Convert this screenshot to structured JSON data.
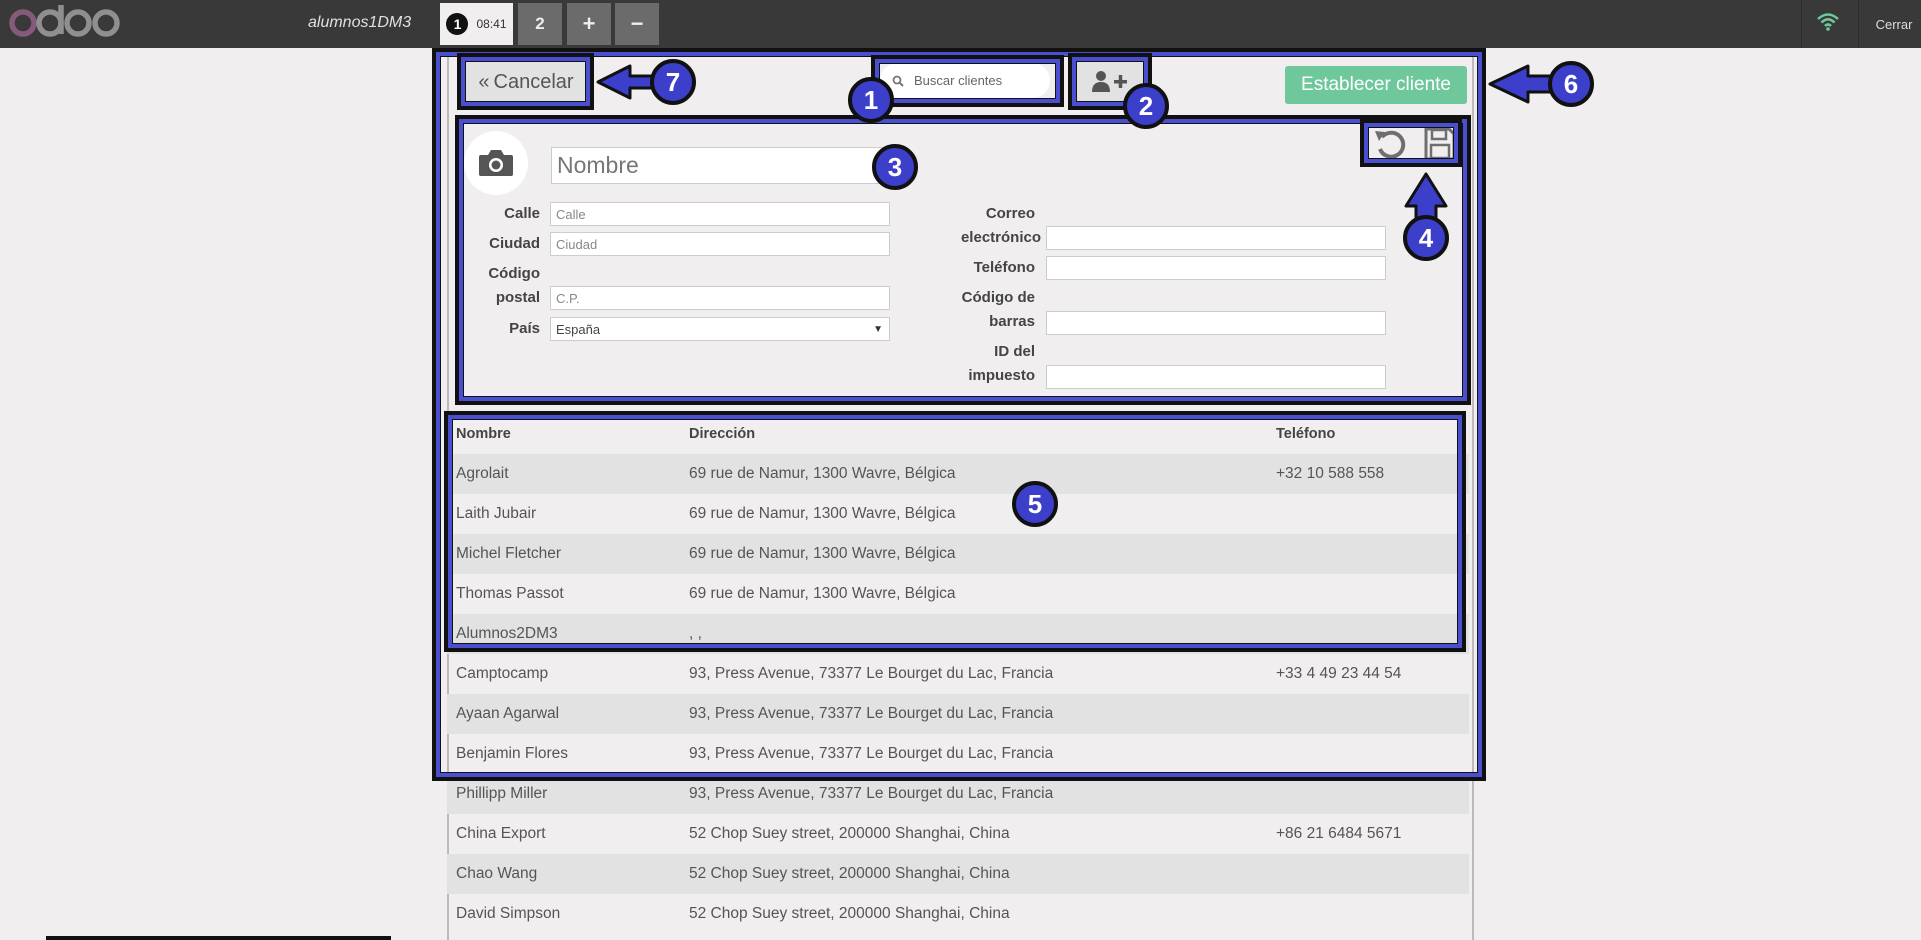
{
  "topbar": {
    "shop_name": "alumnos1DM3",
    "orders": [
      {
        "number": "1",
        "time": "08:41"
      },
      {
        "label": "2"
      }
    ],
    "add_order_label": "+",
    "remove_order_label": "−",
    "close_label": "Cerrar",
    "colors": {
      "bar": "#393939",
      "logo_o": "#875A7B",
      "logo_doo": "#8f8f8f",
      "wifi": "#6ec89b"
    }
  },
  "toolbar": {
    "cancel_label": "Cancelar",
    "cancel_icon": "double-chevron-left-icon",
    "search_placeholder": "Buscar clientes",
    "search_icon": "magnifier-icon",
    "new_customer_icon": "user-plus-icon",
    "set_customer_label": "Establecer cliente",
    "set_customer_color": "#6ec89b"
  },
  "form": {
    "name_placeholder": "Nombre",
    "avatar_icon": "camera-icon",
    "street_label": "Calle",
    "street_placeholder": "Calle",
    "city_label": "Ciudad",
    "city_placeholder": "Ciudad",
    "zip_label_1": "Código",
    "zip_label_2": "postal",
    "zip_placeholder": "C.P.",
    "country_label": "País",
    "country_value": "España",
    "email_label_1": "Correo",
    "email_label_2": "electrónico",
    "phone_label": "Teléfono",
    "barcode_label_1": "Código de",
    "barcode_label_2": "barras",
    "tax_label_1": "ID del",
    "tax_label_2": "impuesto",
    "undo_icon": "undo-icon",
    "save_icon": "floppy-disk-icon"
  },
  "table": {
    "headers": [
      "Nombre",
      "Dirección",
      "Teléfono"
    ],
    "rows": [
      [
        "Agrolait",
        "69 rue de Namur, 1300 Wavre, Bélgica",
        "+32 10 588 558"
      ],
      [
        "Laith Jubair",
        "69 rue de Namur, 1300 Wavre, Bélgica",
        ""
      ],
      [
        "Michel Fletcher",
        "69 rue de Namur, 1300 Wavre, Bélgica",
        ""
      ],
      [
        "Thomas Passot",
        "69 rue de Namur, 1300 Wavre, Bélgica",
        ""
      ],
      [
        "Alumnos2DM3",
        ", ,",
        ""
      ],
      [
        "Camptocamp",
        "93, Press Avenue, 73377 Le Bourget du Lac, Francia",
        "+33 4 49 23 44 54"
      ],
      [
        "Ayaan Agarwal",
        "93, Press Avenue, 73377 Le Bourget du Lac, Francia",
        ""
      ],
      [
        "Benjamin Flores",
        "93, Press Avenue, 73377 Le Bourget du Lac, Francia",
        ""
      ],
      [
        "Phillipp Miller",
        "93, Press Avenue, 73377 Le Bourget du Lac, Francia",
        ""
      ],
      [
        "China Export",
        "52 Chop Suey street, 200000 Shanghai, China",
        "+86 21 6484 5671"
      ],
      [
        "Chao Wang",
        "52 Chop Suey street, 200000 Shanghai, China",
        ""
      ],
      [
        "David Simpson",
        "52 Chop Suey street, 200000 Shanghai, China",
        ""
      ]
    ]
  },
  "annotations": {
    "badges": [
      "1",
      "2",
      "3",
      "4",
      "5",
      "6",
      "7"
    ],
    "color": "#3b3fc9"
  }
}
